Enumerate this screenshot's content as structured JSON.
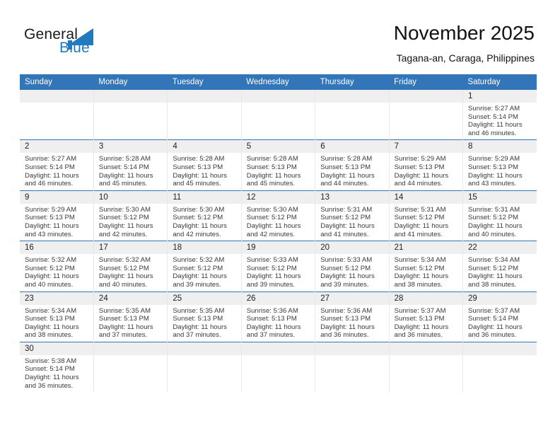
{
  "brand": {
    "word1": "General",
    "word2": "Blue",
    "triangle_icon": "blue-triangle-icon",
    "accent_color": "#1f7ac0"
  },
  "header": {
    "month_title": "November 2025",
    "location": "Tagana-an, Caraga, Philippines"
  },
  "calendar": {
    "header_color": "#3275b8",
    "weekday_headers": [
      "Sunday",
      "Monday",
      "Tuesday",
      "Wednesday",
      "Thursday",
      "Friday",
      "Saturday"
    ],
    "weeks": [
      [
        {
          "day": "",
          "lines": []
        },
        {
          "day": "",
          "lines": []
        },
        {
          "day": "",
          "lines": []
        },
        {
          "day": "",
          "lines": []
        },
        {
          "day": "",
          "lines": []
        },
        {
          "day": "",
          "lines": []
        },
        {
          "day": "1",
          "lines": [
            "Sunrise: 5:27 AM",
            "Sunset: 5:14 PM",
            "Daylight: 11 hours",
            "and 46 minutes."
          ]
        }
      ],
      [
        {
          "day": "2",
          "lines": [
            "Sunrise: 5:27 AM",
            "Sunset: 5:14 PM",
            "Daylight: 11 hours",
            "and 46 minutes."
          ]
        },
        {
          "day": "3",
          "lines": [
            "Sunrise: 5:28 AM",
            "Sunset: 5:14 PM",
            "Daylight: 11 hours",
            "and 45 minutes."
          ]
        },
        {
          "day": "4",
          "lines": [
            "Sunrise: 5:28 AM",
            "Sunset: 5:13 PM",
            "Daylight: 11 hours",
            "and 45 minutes."
          ]
        },
        {
          "day": "5",
          "lines": [
            "Sunrise: 5:28 AM",
            "Sunset: 5:13 PM",
            "Daylight: 11 hours",
            "and 45 minutes."
          ]
        },
        {
          "day": "6",
          "lines": [
            "Sunrise: 5:28 AM",
            "Sunset: 5:13 PM",
            "Daylight: 11 hours",
            "and 44 minutes."
          ]
        },
        {
          "day": "7",
          "lines": [
            "Sunrise: 5:29 AM",
            "Sunset: 5:13 PM",
            "Daylight: 11 hours",
            "and 44 minutes."
          ]
        },
        {
          "day": "8",
          "lines": [
            "Sunrise: 5:29 AM",
            "Sunset: 5:13 PM",
            "Daylight: 11 hours",
            "and 43 minutes."
          ]
        }
      ],
      [
        {
          "day": "9",
          "lines": [
            "Sunrise: 5:29 AM",
            "Sunset: 5:13 PM",
            "Daylight: 11 hours",
            "and 43 minutes."
          ]
        },
        {
          "day": "10",
          "lines": [
            "Sunrise: 5:30 AM",
            "Sunset: 5:12 PM",
            "Daylight: 11 hours",
            "and 42 minutes."
          ]
        },
        {
          "day": "11",
          "lines": [
            "Sunrise: 5:30 AM",
            "Sunset: 5:12 PM",
            "Daylight: 11 hours",
            "and 42 minutes."
          ]
        },
        {
          "day": "12",
          "lines": [
            "Sunrise: 5:30 AM",
            "Sunset: 5:12 PM",
            "Daylight: 11 hours",
            "and 42 minutes."
          ]
        },
        {
          "day": "13",
          "lines": [
            "Sunrise: 5:31 AM",
            "Sunset: 5:12 PM",
            "Daylight: 11 hours",
            "and 41 minutes."
          ]
        },
        {
          "day": "14",
          "lines": [
            "Sunrise: 5:31 AM",
            "Sunset: 5:12 PM",
            "Daylight: 11 hours",
            "and 41 minutes."
          ]
        },
        {
          "day": "15",
          "lines": [
            "Sunrise: 5:31 AM",
            "Sunset: 5:12 PM",
            "Daylight: 11 hours",
            "and 40 minutes."
          ]
        }
      ],
      [
        {
          "day": "16",
          "lines": [
            "Sunrise: 5:32 AM",
            "Sunset: 5:12 PM",
            "Daylight: 11 hours",
            "and 40 minutes."
          ]
        },
        {
          "day": "17",
          "lines": [
            "Sunrise: 5:32 AM",
            "Sunset: 5:12 PM",
            "Daylight: 11 hours",
            "and 40 minutes."
          ]
        },
        {
          "day": "18",
          "lines": [
            "Sunrise: 5:32 AM",
            "Sunset: 5:12 PM",
            "Daylight: 11 hours",
            "and 39 minutes."
          ]
        },
        {
          "day": "19",
          "lines": [
            "Sunrise: 5:33 AM",
            "Sunset: 5:12 PM",
            "Daylight: 11 hours",
            "and 39 minutes."
          ]
        },
        {
          "day": "20",
          "lines": [
            "Sunrise: 5:33 AM",
            "Sunset: 5:12 PM",
            "Daylight: 11 hours",
            "and 39 minutes."
          ]
        },
        {
          "day": "21",
          "lines": [
            "Sunrise: 5:34 AM",
            "Sunset: 5:12 PM",
            "Daylight: 11 hours",
            "and 38 minutes."
          ]
        },
        {
          "day": "22",
          "lines": [
            "Sunrise: 5:34 AM",
            "Sunset: 5:12 PM",
            "Daylight: 11 hours",
            "and 38 minutes."
          ]
        }
      ],
      [
        {
          "day": "23",
          "lines": [
            "Sunrise: 5:34 AM",
            "Sunset: 5:13 PM",
            "Daylight: 11 hours",
            "and 38 minutes."
          ]
        },
        {
          "day": "24",
          "lines": [
            "Sunrise: 5:35 AM",
            "Sunset: 5:13 PM",
            "Daylight: 11 hours",
            "and 37 minutes."
          ]
        },
        {
          "day": "25",
          "lines": [
            "Sunrise: 5:35 AM",
            "Sunset: 5:13 PM",
            "Daylight: 11 hours",
            "and 37 minutes."
          ]
        },
        {
          "day": "26",
          "lines": [
            "Sunrise: 5:36 AM",
            "Sunset: 5:13 PM",
            "Daylight: 11 hours",
            "and 37 minutes."
          ]
        },
        {
          "day": "27",
          "lines": [
            "Sunrise: 5:36 AM",
            "Sunset: 5:13 PM",
            "Daylight: 11 hours",
            "and 36 minutes."
          ]
        },
        {
          "day": "28",
          "lines": [
            "Sunrise: 5:37 AM",
            "Sunset: 5:13 PM",
            "Daylight: 11 hours",
            "and 36 minutes."
          ]
        },
        {
          "day": "29",
          "lines": [
            "Sunrise: 5:37 AM",
            "Sunset: 5:14 PM",
            "Daylight: 11 hours",
            "and 36 minutes."
          ]
        }
      ],
      [
        {
          "day": "30",
          "lines": [
            "Sunrise: 5:38 AM",
            "Sunset: 5:14 PM",
            "Daylight: 11 hours",
            "and 36 minutes."
          ]
        },
        {
          "day": "",
          "lines": []
        },
        {
          "day": "",
          "lines": []
        },
        {
          "day": "",
          "lines": []
        },
        {
          "day": "",
          "lines": []
        },
        {
          "day": "",
          "lines": []
        },
        {
          "day": "",
          "lines": []
        }
      ]
    ]
  }
}
